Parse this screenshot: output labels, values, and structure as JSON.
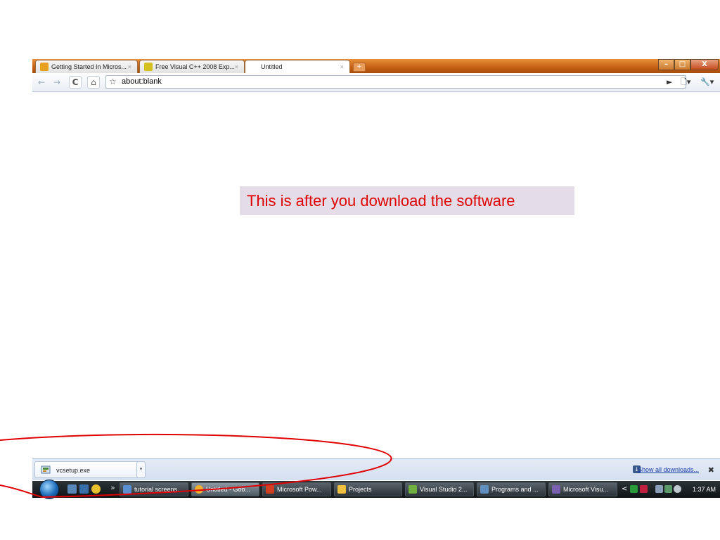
{
  "browser": {
    "tabs": [
      {
        "title": "Getting Started In Micros...",
        "close": "×",
        "favicon_color": "#e8a020"
      },
      {
        "title": "Free Visual C++ 2008 Exp...",
        "close": "×",
        "favicon_color": "#d4c020"
      },
      {
        "title": "Untitled",
        "close": "×",
        "active": true
      }
    ],
    "new_tab_label": "+",
    "window_buttons": {
      "minimize": "–",
      "maximize": "□",
      "close": "X"
    },
    "toolbar": {
      "back": "←",
      "forward": "→",
      "reload": "C",
      "home": "⌂",
      "star": "☆",
      "url": "about:blank",
      "go": "►",
      "page_menu": "🗋▾",
      "wrench_menu": "🔧▾"
    }
  },
  "annotation": {
    "text": "This is after you download the software",
    "color": "#e00000"
  },
  "download_shelf": {
    "item_name": "vcsetup.exe",
    "item_arrow": "▾",
    "show_all": "Show all downloads...",
    "close": "✖"
  },
  "taskbar": {
    "quick_launch_chevron": "»",
    "tasks": [
      {
        "label": "tutorial screens...",
        "icon_color": "#5a8fd0"
      },
      {
        "label": "Untitled - Goo...",
        "icon_color": "#f0b030",
        "active": true
      },
      {
        "label": "Microsoft Pow...",
        "icon_color": "#d04020"
      },
      {
        "label": "Projects",
        "icon_color": "#f0c040"
      },
      {
        "label": "Visual Studio 2...",
        "icon_color": "#70b040"
      },
      {
        "label": "Programs and ...",
        "icon_color": "#6090c0"
      },
      {
        "label": "Microsoft Visu...",
        "icon_color": "#7a60b0"
      }
    ],
    "tray_chevron": "<",
    "clock": "1:37 AM"
  }
}
